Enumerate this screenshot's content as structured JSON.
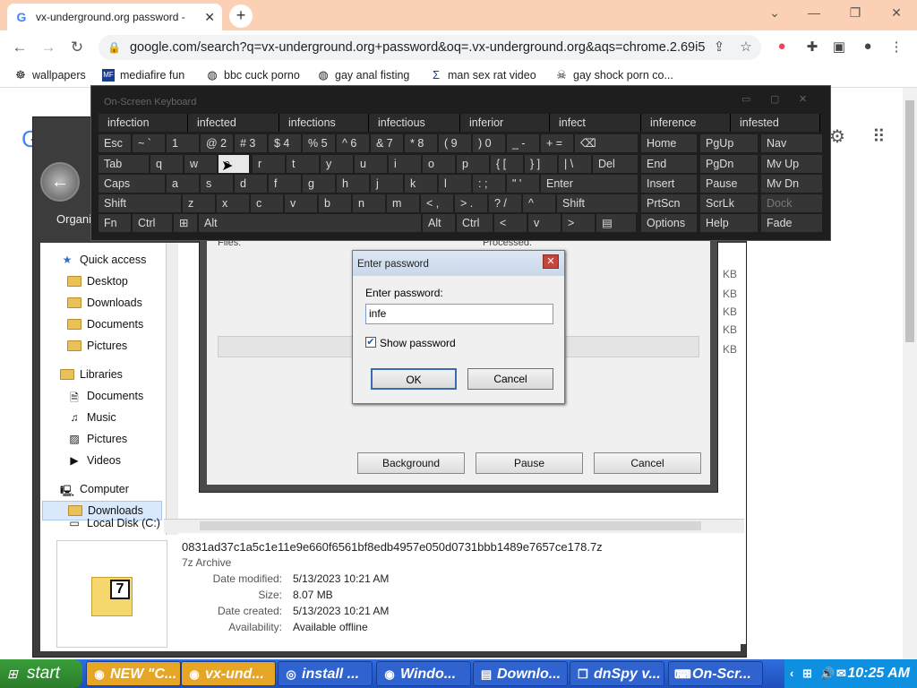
{
  "browser": {
    "tab_title": "vx-underground.org password -",
    "url": "google.com/search?q=vx-underground.org+password&oq=.vx-underground.org&aqs=chrome.2.69i5",
    "bookmarks": [
      "wallpapers",
      "mediafire fun",
      "bbc cuck porno",
      "gay anal fisting",
      "man sex rat video",
      "gay shock porn co..."
    ]
  },
  "osk": {
    "title": "On-Screen Keyboard",
    "suggestions": [
      "infection",
      "infected",
      "infections",
      "infectious",
      "inferior",
      "infect",
      "inference",
      "infested"
    ],
    "row1": [
      "Esc",
      "~ `",
      "1",
      "@ 2",
      "# 3",
      "$ 4",
      "% 5",
      "^ 6",
      "& 7",
      "* 8",
      "( 9",
      ") 0",
      "_ -",
      "+ =",
      "⌫",
      "Home",
      "PgUp",
      "Nav"
    ],
    "row2": [
      "Tab",
      "q",
      "w",
      "e",
      "r",
      "t",
      "y",
      "u",
      "i",
      "o",
      "p",
      "{ [",
      "} ]",
      "| \\",
      "Del",
      "End",
      "PgDn",
      "Mv Up"
    ],
    "row3": [
      "Caps",
      "a",
      "s",
      "d",
      "f",
      "g",
      "h",
      "j",
      "k",
      "l",
      ": ;",
      "\" '",
      "Enter",
      "Insert",
      "Pause",
      "Mv Dn"
    ],
    "row4": [
      "Shift",
      "z",
      "x",
      "c",
      "v",
      "b",
      "n",
      "m",
      "< ,",
      "> .",
      "? /",
      "^",
      "Shift",
      "PrtScn",
      "ScrLk",
      "Dock"
    ],
    "row5": [
      "Fn",
      "Ctrl",
      "⊞",
      "Alt",
      "Alt",
      "Ctrl",
      "<",
      "v",
      ">",
      "▤",
      "Options",
      "Help",
      "Fade"
    ]
  },
  "explorer": {
    "title_partial": "Organi",
    "sidebar": [
      {
        "label": "Quick access",
        "type": "star"
      },
      {
        "label": "Desktop",
        "type": "folder",
        "pinned": true
      },
      {
        "label": "Downloads",
        "type": "folder",
        "pinned": true
      },
      {
        "label": "Documents",
        "type": "folder",
        "pinned": true
      },
      {
        "label": "Pictures",
        "type": "folder",
        "pinned": true
      },
      {
        "label": "Libraries",
        "type": "folder"
      },
      {
        "label": "Documents",
        "type": "folder"
      },
      {
        "label": "Music",
        "type": "folder"
      },
      {
        "label": "Pictures",
        "type": "folder"
      },
      {
        "label": "Videos",
        "type": "folder"
      },
      {
        "label": "Computer",
        "type": "computer"
      },
      {
        "label": "Downloads",
        "type": "folder",
        "selected": true
      },
      {
        "label": "Local Disk (C:)",
        "type": "disk"
      }
    ],
    "details": {
      "filename": "0831ad37c1a5c1e11e9e660f6561bf8edb4957e050d0731bbb1489e7657ce178.7z",
      "type": "7z Archive",
      "date_modified_label": "Date modified:",
      "date_modified": "5/13/2023 10:21 AM",
      "size_label": "Size:",
      "size": "8.07 MB",
      "date_created_label": "Date created:",
      "date_created": "5/13/2023 10:21 AM",
      "availability_label": "Availability:",
      "availability": "Available offline"
    },
    "kb_label": "KB"
  },
  "extract": {
    "files_label": "Files:",
    "processed_label": "Processed:",
    "background_label": "Background",
    "pause_label": "Pause",
    "cancel_label": "Cancel"
  },
  "dialog": {
    "title": "Enter password",
    "prompt": "Enter password:",
    "value": "infe",
    "show_password": "Show password",
    "ok": "OK",
    "cancel": "Cancel"
  },
  "taskbar": {
    "start": "start",
    "items": [
      "NEW \"C...",
      "vx-und...",
      "install ...",
      "Windo...",
      "Downlo...",
      "dnSpy v...",
      "On-Scr..."
    ],
    "time": "10:25 AM"
  }
}
